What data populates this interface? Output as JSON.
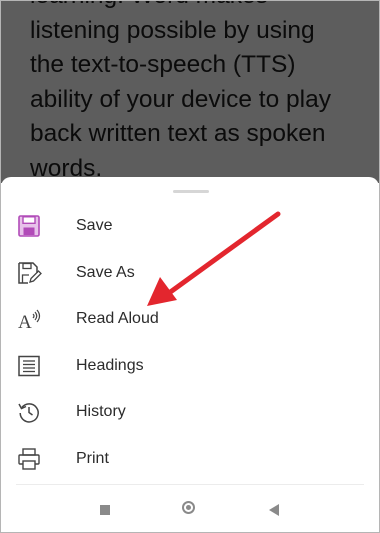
{
  "document": {
    "lines": [
      "learning. Word makes",
      "listening possible by using",
      "the text-to-speech (TTS)",
      "ability of your device to play",
      "back written text as spoken",
      "words."
    ]
  },
  "menu": {
    "items": [
      {
        "label": "Save",
        "icon": "save-icon"
      },
      {
        "label": "Save As",
        "icon": "save-as-icon"
      },
      {
        "label": "Read Aloud",
        "icon": "read-aloud-icon"
      },
      {
        "label": "Headings",
        "icon": "headings-icon"
      },
      {
        "label": "History",
        "icon": "history-icon"
      },
      {
        "label": "Print",
        "icon": "print-icon"
      }
    ]
  },
  "navbar": {
    "buttons": [
      "recents-icon",
      "home-icon",
      "back-icon"
    ]
  },
  "colors": {
    "overlay": "#5d5d5d",
    "save_accent": "#b14bb8",
    "arrow": "#e3262e",
    "icon_stroke": "#444444"
  }
}
